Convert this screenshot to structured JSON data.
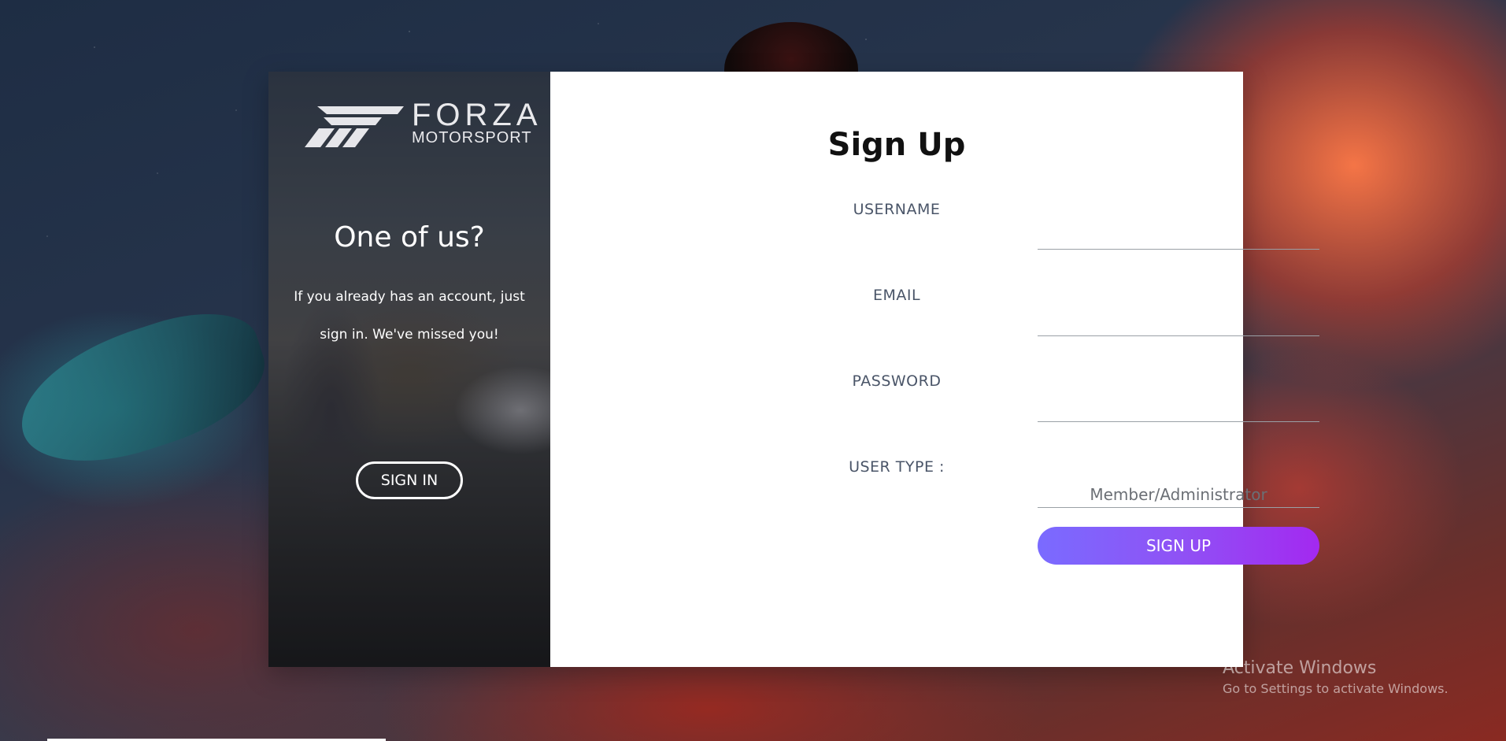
{
  "logo": {
    "main": "FORZA",
    "sub": "MOTORSPORT",
    "icon": "forza-logo-mark"
  },
  "left_panel": {
    "title": "One of us?",
    "text": "If you already has an account, just sign in. We've missed you!",
    "signin_label": "SIGN IN"
  },
  "form": {
    "title": "Sign Up",
    "username_label": "USERNAME",
    "email_label": "EMAIL",
    "password_label": "PASSWORD",
    "usertype_label": "USER TYPE :",
    "usertype_placeholder": "Member/Administrator",
    "signup_label": "SIGN UP"
  },
  "watermark": {
    "title": "Activate Windows",
    "subtitle": "Go to Settings to activate Windows."
  },
  "colors": {
    "signup_gradient_start": "#7a6bff",
    "signup_gradient_end": "#a329f0",
    "label": "#4a5568"
  }
}
